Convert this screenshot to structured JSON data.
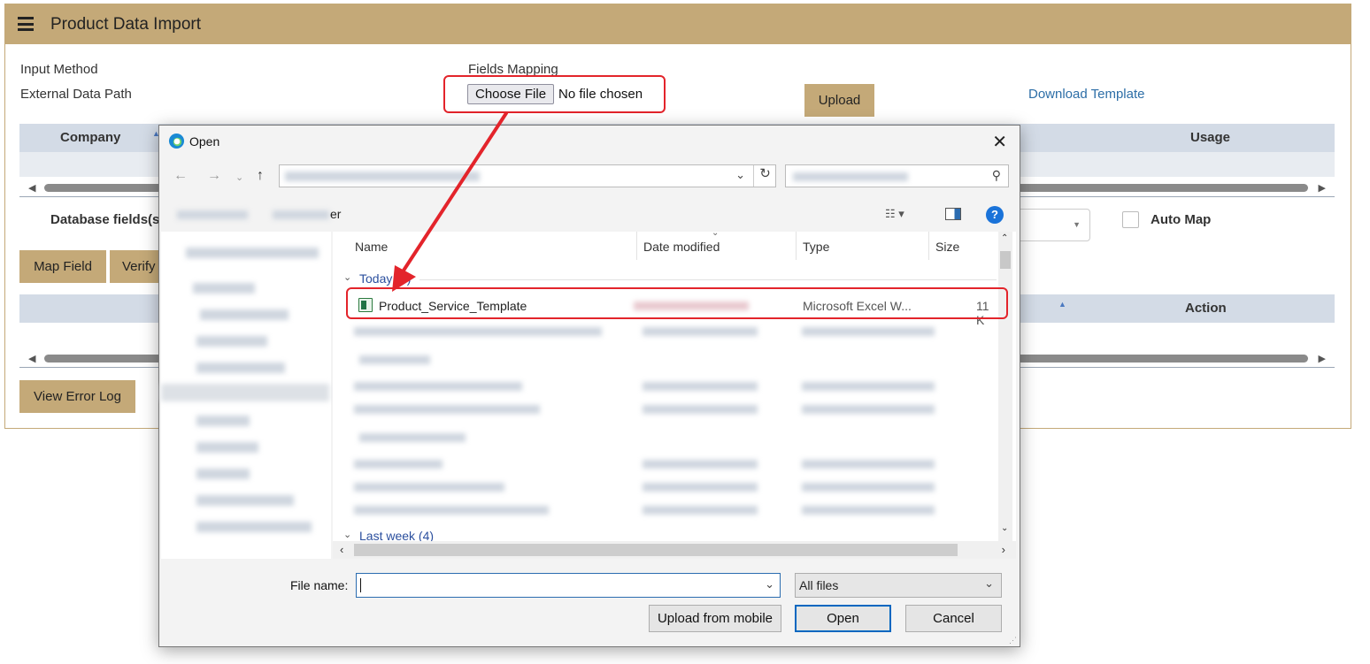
{
  "app": {
    "title": "Product Data Import"
  },
  "form": {
    "input_method_label": "Input Method",
    "external_data_path_label": "External Data Path",
    "fields_mapping_label": "Fields Mapping",
    "choose_file_label": "Choose File",
    "no_file_text": "No file chosen",
    "upload_label": "Upload",
    "download_template_label": "Download Template"
  },
  "grid1": {
    "col_company": "Company",
    "col_usage": "Usage"
  },
  "mapping": {
    "database_fields_label": "Database fields(s)",
    "auto_map_label": "Auto Map",
    "map_field_label": "Map Field",
    "verify_label": "Verify"
  },
  "grid2": {
    "col_action": "Action"
  },
  "view_error_log_label": "View Error Log",
  "dialog": {
    "title": "Open",
    "new_folder_fragment": "er",
    "columns": {
      "name": "Name",
      "date_modified": "Date modified",
      "type": "Type",
      "size": "Size"
    },
    "groups": {
      "today": "Today (2)",
      "last_week": "Last week (4)"
    },
    "selected_file": {
      "name": "Product_Service_Template",
      "type": "Microsoft Excel W...",
      "size": "11 K"
    },
    "file_name_label": "File name:",
    "file_name_value": "",
    "filter_value": "All files",
    "upload_mobile_label": "Upload from mobile",
    "open_label": "Open",
    "cancel_label": "Cancel"
  },
  "colors": {
    "accent": "#c4a978",
    "highlight": "#e3242b",
    "grid_header": "#d3dbe6",
    "link": "#2d6ea7"
  }
}
